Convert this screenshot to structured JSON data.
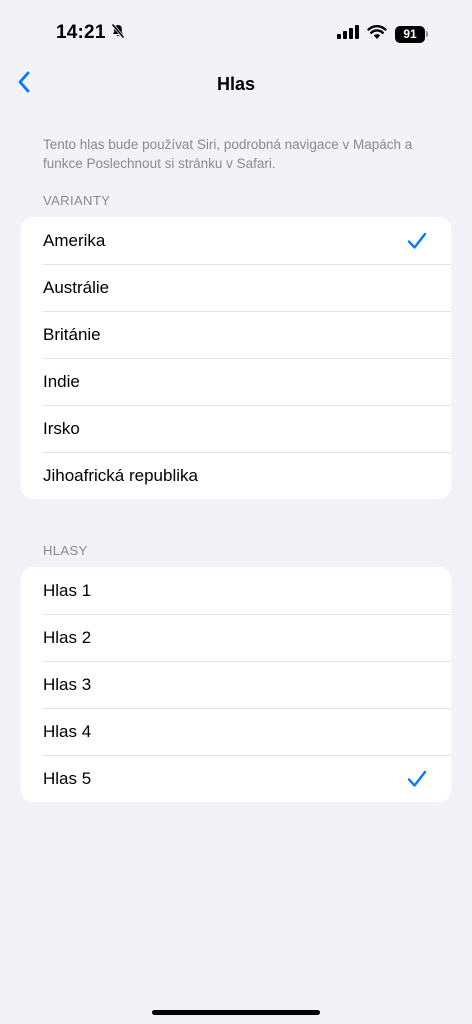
{
  "status_bar": {
    "time": "14:21",
    "battery": "91",
    "icons": [
      "bell-slash-icon",
      "signal-icon",
      "wifi-icon",
      "battery-icon"
    ]
  },
  "nav": {
    "title": "Hlas",
    "back_icon": "chevron-left-icon"
  },
  "description": "Tento hlas bude používat Siri, podrobná navigace v Mapách a funkce Poslechnout si stránku v Safari.",
  "sections": [
    {
      "header": "VARIANTY",
      "items": [
        {
          "label": "Amerika",
          "selected": true
        },
        {
          "label": "Austrálie",
          "selected": false
        },
        {
          "label": "Británie",
          "selected": false
        },
        {
          "label": "Indie",
          "selected": false
        },
        {
          "label": "Irsko",
          "selected": false
        },
        {
          "label": "Jihoafrická republika",
          "selected": false
        }
      ]
    },
    {
      "header": "HLASY",
      "items": [
        {
          "label": "Hlas 1",
          "selected": false
        },
        {
          "label": "Hlas 2",
          "selected": false
        },
        {
          "label": "Hlas 3",
          "selected": false
        },
        {
          "label": "Hlas 4",
          "selected": false
        },
        {
          "label": "Hlas 5",
          "selected": true
        }
      ]
    }
  ],
  "colors": {
    "accent": "#007aff",
    "background": "#f2f2f7",
    "secondary_text": "#8a8a8e"
  }
}
